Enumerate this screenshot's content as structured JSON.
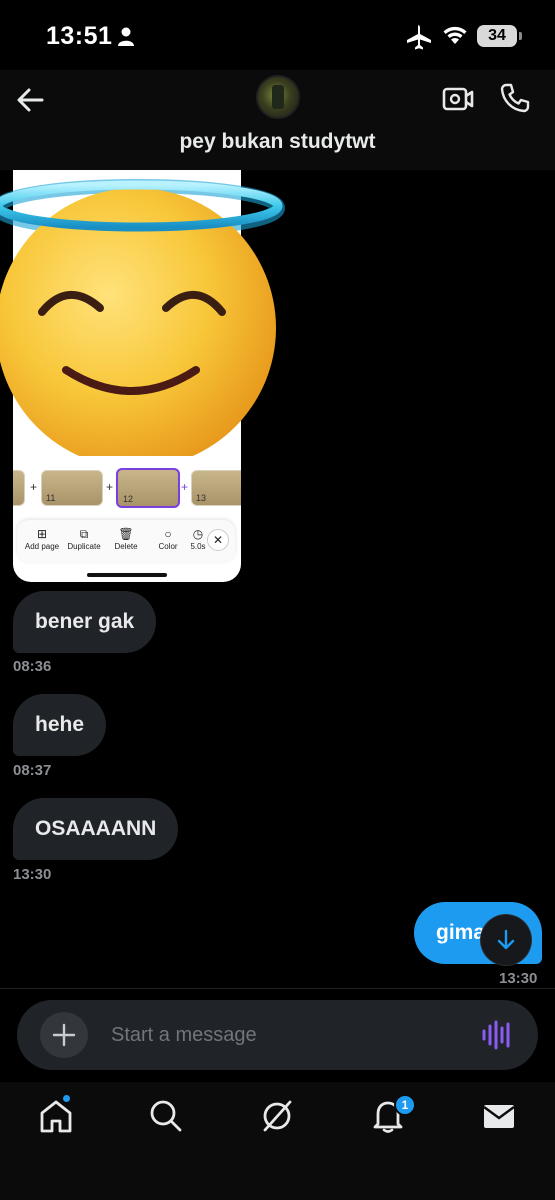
{
  "status_bar": {
    "time": "13:51",
    "battery": "34",
    "icons": [
      "person-icon",
      "airplane-icon",
      "wifi-icon",
      "battery-icon"
    ]
  },
  "header": {
    "contact_name": "pey bukan studytwt",
    "icons": [
      "back-arrow-icon",
      "video-call-icon",
      "phone-icon"
    ]
  },
  "shared_image": {
    "thumbnails": [
      "11",
      "12",
      "13"
    ],
    "toolbar": {
      "add_page": "Add page",
      "duplicate": "Duplicate",
      "delete": "Delete",
      "color": "Color",
      "timing": "5.0s"
    },
    "sticker": "smiling-face-with-halo"
  },
  "messages": [
    {
      "text": "bener gak",
      "time": "08:36",
      "direction": "incoming"
    },
    {
      "text": "hehe",
      "time": "08:37",
      "direction": "incoming"
    },
    {
      "text": "OSAAAANN",
      "time": "13:30",
      "direction": "incoming"
    },
    {
      "text": "gimana",
      "time": "13:30",
      "direction": "outgoing"
    }
  ],
  "composer": {
    "placeholder": "Start a message"
  },
  "bottom_nav": {
    "items": [
      "home-icon",
      "search-icon",
      "grok-icon",
      "notifications-icon",
      "messages-icon"
    ],
    "notifications_badge": "1"
  },
  "colors": {
    "accent": "#1d9bf0",
    "incoming_bubble": "#202327",
    "voice_accent": "#8a5cf6"
  }
}
